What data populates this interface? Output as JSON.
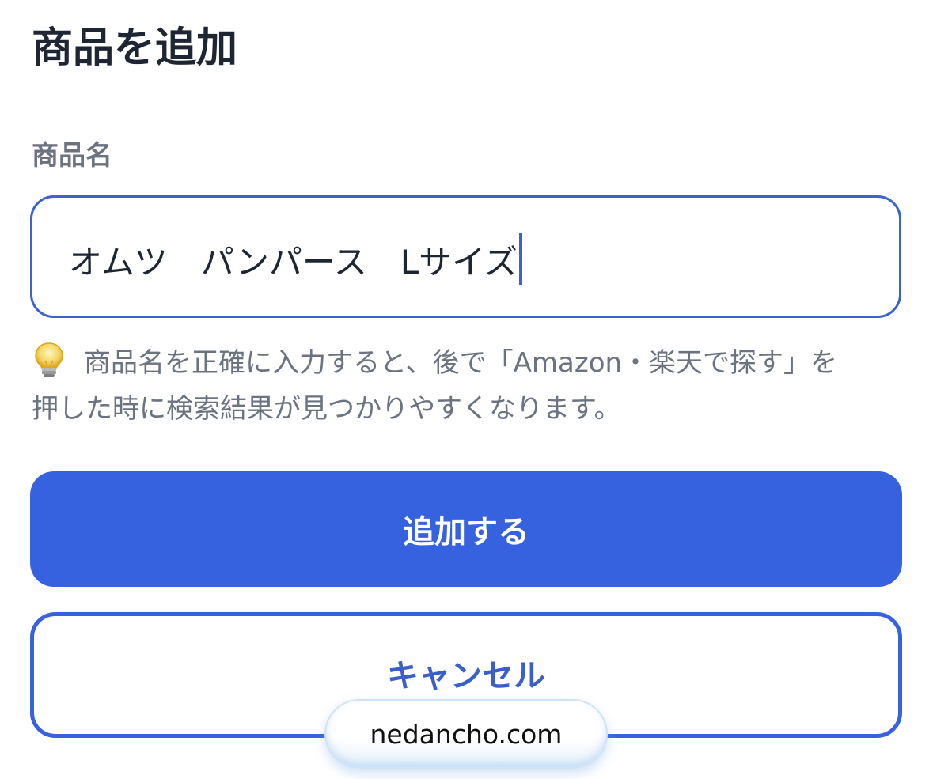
{
  "header": {
    "title": "商品を追加"
  },
  "form": {
    "name_label": "商品名",
    "name_value": "オムツ　パンパース　Lサイズ",
    "hint_icon": "lightbulb-icon",
    "hint_line1": "商品名を正確に入力すると、後で「Amazon・楽天で探す」を",
    "hint_line2": "押した時に検索結果が見つかりやすくなります。"
  },
  "actions": {
    "add_label": "追加する",
    "cancel_label": "キャンセル"
  },
  "watermark": {
    "text": "nedancho.com"
  },
  "colors": {
    "primary": "#3762df",
    "title": "#1f2633",
    "muted": "#6b7280",
    "background": "#ffffff"
  }
}
